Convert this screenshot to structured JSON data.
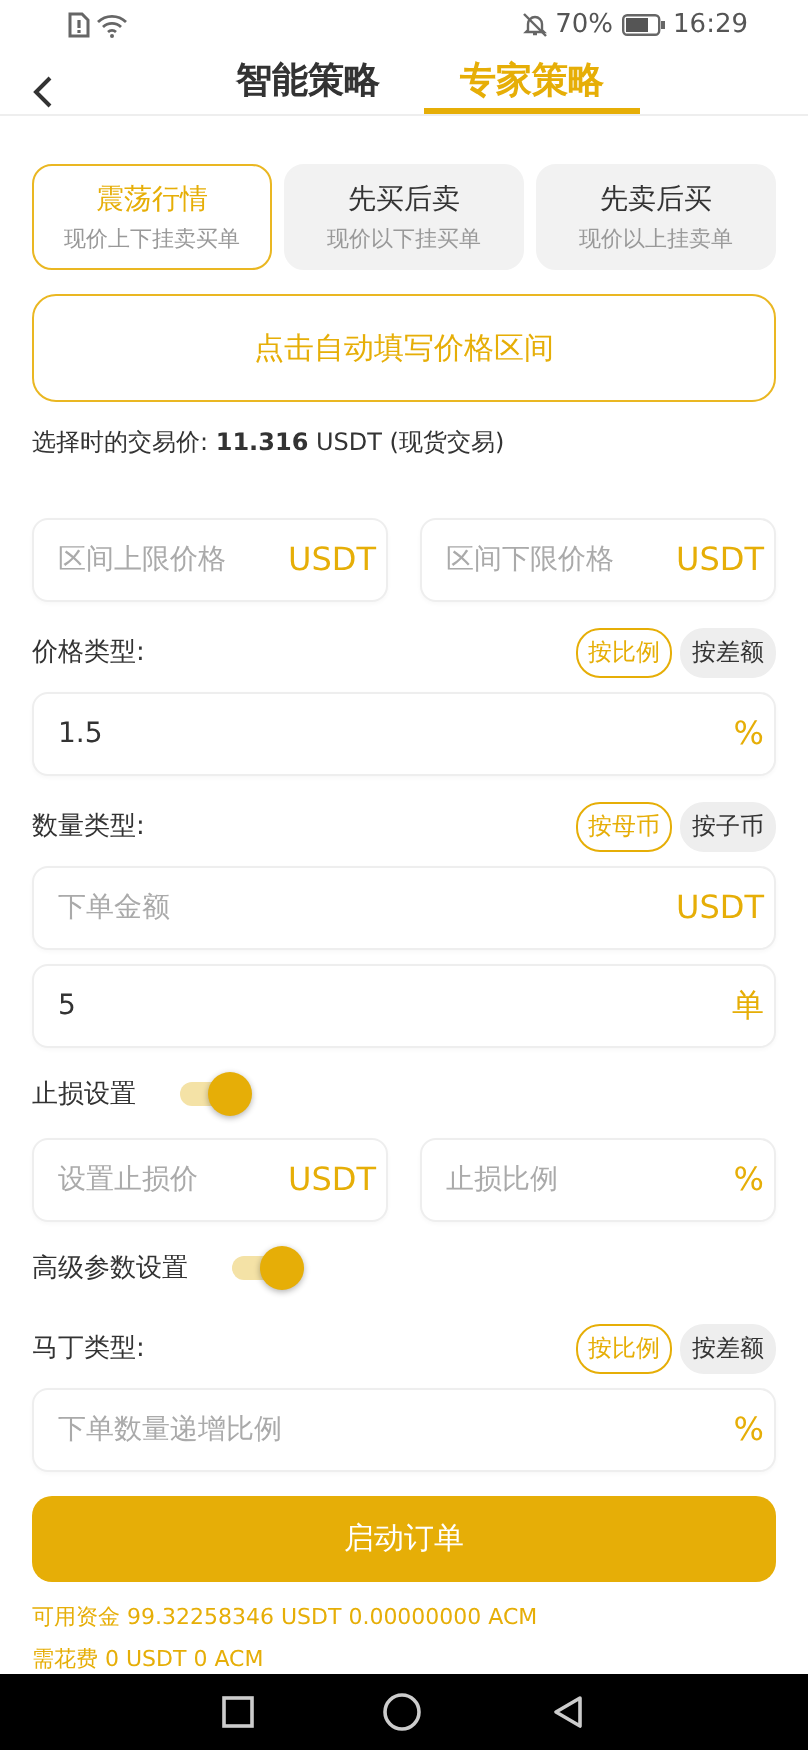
{
  "status_bar": {
    "battery_percent": "70%",
    "time": "16:29"
  },
  "tabs": [
    {
      "label": "智能策略",
      "selected": false
    },
    {
      "label": "专家策略",
      "selected": true
    }
  ],
  "mode_cards": [
    {
      "title": "震荡行情",
      "subtitle": "现价上下挂卖买单",
      "selected": true
    },
    {
      "title": "先买后卖",
      "subtitle": "现价以下挂买单",
      "selected": false
    },
    {
      "title": "先卖后买",
      "subtitle": "现价以上挂卖单",
      "selected": false
    }
  ],
  "auto_fill_button": "点击自动填写价格区间",
  "price_note": "选择时的交易价: **11.316** USDT (现货交易)",
  "form": [
    {
      "kind": "fields",
      "fields": [
        {
          "placeholder": "区间上限价格",
          "unit": "USDT"
        },
        {
          "placeholder": "区间下限价格",
          "unit": "USDT"
        }
      ]
    },
    {
      "kind": "type_row",
      "label": "价格类型:",
      "options": [
        {
          "label": "按比例",
          "selected": true
        },
        {
          "label": "按差额",
          "selected": false
        }
      ]
    },
    {
      "kind": "fields",
      "fields": [
        {
          "value": "1.5",
          "unit": "%"
        }
      ]
    },
    {
      "kind": "type_row",
      "label": "数量类型:",
      "options": [
        {
          "label": "按母币",
          "selected": true
        },
        {
          "label": "按子币",
          "selected": false
        }
      ]
    },
    {
      "kind": "fields",
      "fields": [
        {
          "placeholder": "下单金额",
          "unit": "USDT"
        }
      ]
    },
    {
      "kind": "fields",
      "fields": [
        {
          "value": "5",
          "unit": "单"
        }
      ]
    },
    {
      "kind": "toggle",
      "label": "止损设置",
      "on": true
    },
    {
      "kind": "fields",
      "fields": [
        {
          "placeholder": "设置止损价",
          "unit": "USDT"
        },
        {
          "placeholder": "止损比例",
          "unit": "%"
        }
      ]
    },
    {
      "kind": "toggle",
      "label": "高级参数设置",
      "on": true
    },
    {
      "kind": "type_row",
      "label": "马丁类型:",
      "options": [
        {
          "label": "按比例",
          "selected": true
        },
        {
          "label": "按差额",
          "selected": false
        }
      ]
    },
    {
      "kind": "fields",
      "fields": [
        {
          "placeholder": "下单数量递增比例",
          "unit": "%"
        }
      ]
    }
  ],
  "start_button": "启动订单",
  "footer_lines": [
    "可用资金 99.32258346 USDT 0.00000000 ACM",
    "需花费 0 USDT 0 ACM"
  ]
}
